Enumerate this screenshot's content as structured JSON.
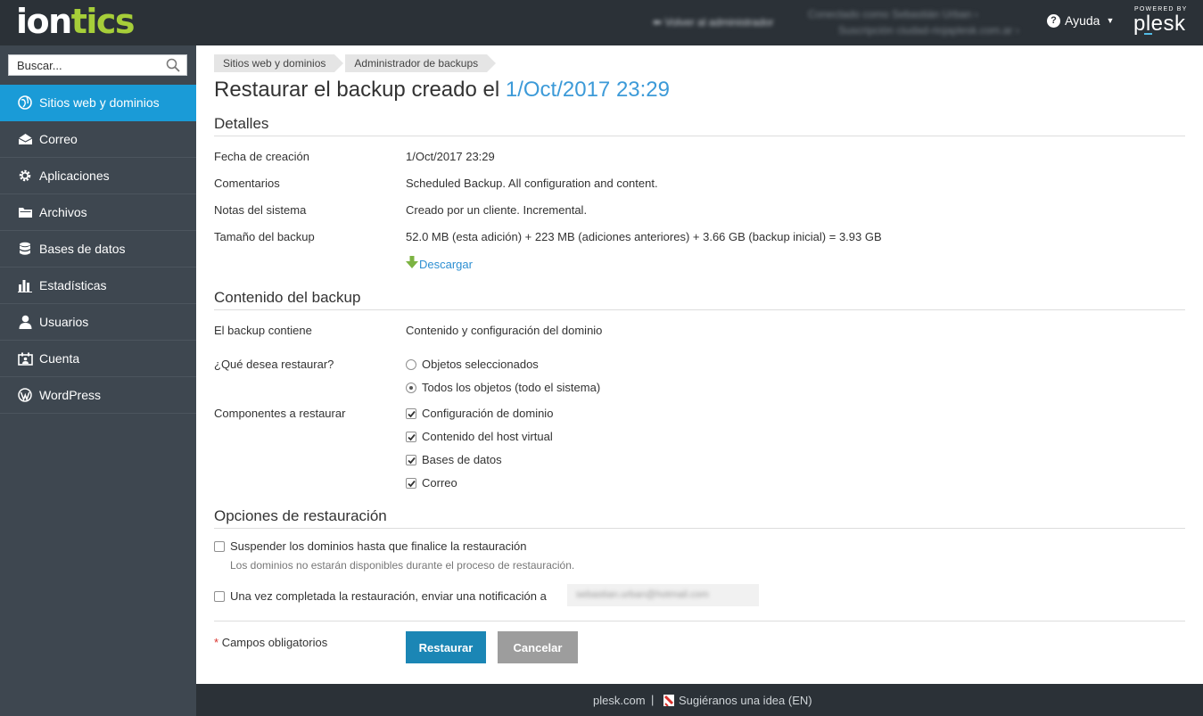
{
  "header": {
    "logo_part1": "ion",
    "logo_part2": "tics",
    "impersonate_label": "Volver al administrador",
    "logged_as_label": "Conectado como",
    "logged_as_value": "Sebastián Urban",
    "subscription_label": "Suscripción",
    "subscription_value": "ciudad-riojaplesk.com.ar",
    "help_label": "Ayuda",
    "powered_by": "POWERED BY",
    "brand": "plesk"
  },
  "sidebar": {
    "search_placeholder": "Buscar...",
    "items": [
      {
        "label": "Sitios web y dominios",
        "icon": "globe-icon",
        "active": true
      },
      {
        "label": "Correo",
        "icon": "mail-icon",
        "active": false
      },
      {
        "label": "Aplicaciones",
        "icon": "gear-icon",
        "active": false
      },
      {
        "label": "Archivos",
        "icon": "folder-icon",
        "active": false
      },
      {
        "label": "Bases de datos",
        "icon": "database-icon",
        "active": false
      },
      {
        "label": "Estadísticas",
        "icon": "bar-chart-icon",
        "active": false
      },
      {
        "label": "Usuarios",
        "icon": "user-icon",
        "active": false
      },
      {
        "label": "Cuenta",
        "icon": "account-icon",
        "active": false
      },
      {
        "label": "WordPress",
        "icon": "wordpress-icon",
        "active": false
      }
    ]
  },
  "breadcrumbs": [
    "Sitios web y dominios",
    "Administrador de backups"
  ],
  "page": {
    "title_prefix": "Restaurar el backup creado el",
    "title_date": "1/Oct/2017 23:29"
  },
  "details": {
    "section_title": "Detalles",
    "rows": [
      {
        "label": "Fecha de creación",
        "value": "1/Oct/2017 23:29"
      },
      {
        "label": "Comentarios",
        "value": "Scheduled Backup. All configuration and content."
      },
      {
        "label": "Notas del sistema",
        "value": "Creado por un cliente. Incremental."
      },
      {
        "label": "Tamaño del backup",
        "value": "52.0 MB (esta adición) + 223 MB (adiciones anteriores) + 3.66 GB (backup inicial) = 3.93 GB"
      }
    ],
    "download_label": "Descargar"
  },
  "content": {
    "section_title": "Contenido del backup",
    "contains_label": "El backup contiene",
    "contains_value": "Contenido y configuración del dominio",
    "what_label": "¿Qué desea restaurar?",
    "what_options": [
      {
        "label": "Objetos seleccionados",
        "selected": false
      },
      {
        "label": "Todos los objetos (todo el sistema)",
        "selected": true
      }
    ],
    "components_label": "Componentes a restaurar",
    "components": [
      {
        "label": "Configuración de dominio",
        "checked": true
      },
      {
        "label": "Contenido del host virtual",
        "checked": true
      },
      {
        "label": "Bases de datos",
        "checked": true
      },
      {
        "label": "Correo",
        "checked": true
      }
    ]
  },
  "options": {
    "section_title": "Opciones de restauración",
    "suspend_label": "Suspender los dominios hasta que finalice la restauración",
    "suspend_hint": "Los dominios no estarán disponibles durante el proceso de restauración.",
    "notify_label": "Una vez completada la restauración, enviar una notificación a",
    "notify_email": "sebastian.urban@hotmail.com"
  },
  "form": {
    "required_star": "*",
    "required_label": "Campos obligatorios",
    "submit_label": "Restaurar",
    "cancel_label": "Cancelar"
  },
  "footer": {
    "link1": "plesk.com",
    "separator": "|",
    "link2": "Sugiéranos una idea (EN)"
  }
}
